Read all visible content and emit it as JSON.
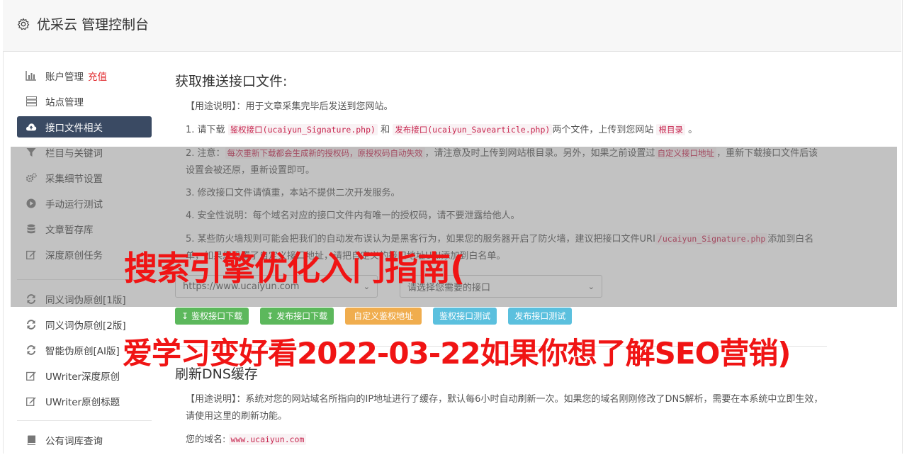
{
  "app": {
    "title": "优采云 管理控制台"
  },
  "sidebar": {
    "items": [
      {
        "label": "账户管理",
        "badge": "充值",
        "icon": "bar-chart-icon"
      },
      {
        "label": "站点管理",
        "icon": "server-icon"
      },
      {
        "label": "接口文件相关",
        "icon": "cloud-upload-icon",
        "active": true
      },
      {
        "label": "栏目与关键词",
        "icon": "filter-icon"
      },
      {
        "label": "采集细节设置",
        "icon": "gears-icon"
      },
      {
        "label": "手动运行测试",
        "icon": "play-circle-icon"
      },
      {
        "label": "文章暂存库",
        "icon": "database-icon"
      },
      {
        "label": "深度原创任务",
        "icon": "edit-icon"
      },
      {
        "label": "同义词伪原创[1版]",
        "icon": "refresh-icon"
      },
      {
        "label": "同义词伪原创[2版]",
        "icon": "refresh-icon"
      },
      {
        "label": "智能伪原创[AI版]",
        "icon": "refresh-icon"
      },
      {
        "label": "UWriter深度原创",
        "icon": "edit-icon"
      },
      {
        "label": "UWriter原创标题",
        "icon": "edit-icon"
      },
      {
        "label": "公有词库查询",
        "icon": "book-icon"
      }
    ]
  },
  "section1": {
    "title": "获取推送接口文件:",
    "usage_prefix": "【用途说明】：用于文章采集完毕后发送到您网站。",
    "line1": {
      "num": "1. 请下载",
      "code1": "鉴权接口(ucaiyun_Signature.php)",
      "and": "和",
      "code2": "发布接口(ucaiyun_Savearticle.php)",
      "tail": "两个文件，上传到您网站",
      "code3": "根目录",
      "end": "。"
    },
    "line2": {
      "num": "2. 注意：",
      "code1": "每次重新下载都会生成新的授权码，原授权码自动失效",
      "mid": "，请注意及时上传到网站根目录。另外，如果之前设置过",
      "code2": "自定义接口地址",
      "tail": "，重新下载接口文件后该设置会被还原，重新设置即可。"
    },
    "line3": "3. 修改接口文件请慎重，本站不提供二次开发服务。",
    "line4": "4. 安全性说明：每个域名对应的接口文件内有唯一的授权码，请不要泄露给他人。",
    "line5": {
      "text": "5. 某些防火墙规则可能会把我们的自动发布误认为是黑客行为，如果您的服务器开启了防火墙，建议把接口文件URI",
      "code": "/ucaiyun_Signature.php",
      "tail1": "添",
      "tail2": "加到白名单，如果您设置了自定义接口地址，请把自定义的接口地址URI添加到白名单。"
    },
    "select_site": "https://www.ucaiyun.com",
    "select_iface": "请选择您需要的接口",
    "btn_sig_download": "鉴权接口下载",
    "btn_pub_download": "发布接口下载",
    "btn_custom": "自定义鉴权地址",
    "btn_sig_test": "鉴权接口测试",
    "btn_pub_test": "发布接口测试"
  },
  "section2": {
    "title": "刷新DNS缓存",
    "usage": "【用途说明】：系统对您的网站域名所指向的IP地址进行了缓存，默认每6小时自动刷新一次。如果您的域名刚刚修改了DNS解析，需要在本系统中立即生效，请使用这里的刷新功能。",
    "domain_label": "您的域名:",
    "domain_value": "www.ucaiyun.com"
  },
  "watermark": {
    "line1": "搜索引擎优化入门指南(",
    "line2": "爱学习变好看2022-03-22如果你想了解SEO营销)"
  },
  "colors": {
    "active_bg": "#3a4a63",
    "green": "#5cb85c",
    "orange": "#f0ad4e",
    "blue": "#5bc0de",
    "watermark": "#f01414"
  }
}
